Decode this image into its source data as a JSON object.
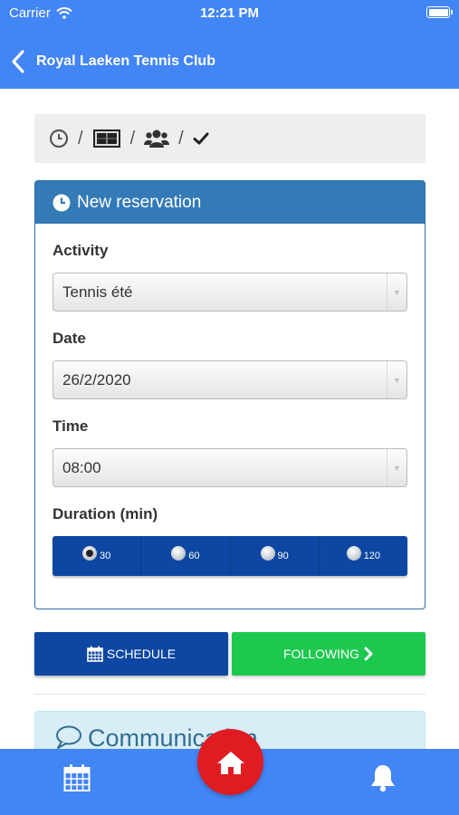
{
  "status_bar": {
    "carrier": "Carrier",
    "time": "12:21 PM"
  },
  "nav": {
    "title": "Royal Laeken Tennis Club",
    "back_icon": "chevron-left-icon"
  },
  "steps": [
    {
      "icon": "clock-icon"
    },
    {
      "icon": "court-icon"
    },
    {
      "icon": "users-icon"
    },
    {
      "icon": "check-icon"
    }
  ],
  "panel": {
    "title": "New reservation",
    "activity": {
      "label": "Activity",
      "value": "Tennis été"
    },
    "date": {
      "label": "Date",
      "value": "26/2/2020"
    },
    "time": {
      "label": "Time",
      "value": "08:00"
    },
    "duration": {
      "label": "Duration (min)",
      "options": [
        "30",
        "60",
        "90",
        "120"
      ],
      "selected": "30"
    }
  },
  "actions": {
    "schedule": "SCHEDULE",
    "following": "FOLLOWING"
  },
  "communication": {
    "title": "Communication"
  },
  "tabbar": {
    "left_icon": "calendar-icon",
    "center_icon": "home-icon",
    "right_icon": "bell-icon"
  },
  "colors": {
    "bar_blue": "#4285f4",
    "panel_blue": "#337ab7",
    "dark_blue": "#0d47a1",
    "green": "#1dc84f",
    "red": "#e01b22"
  }
}
